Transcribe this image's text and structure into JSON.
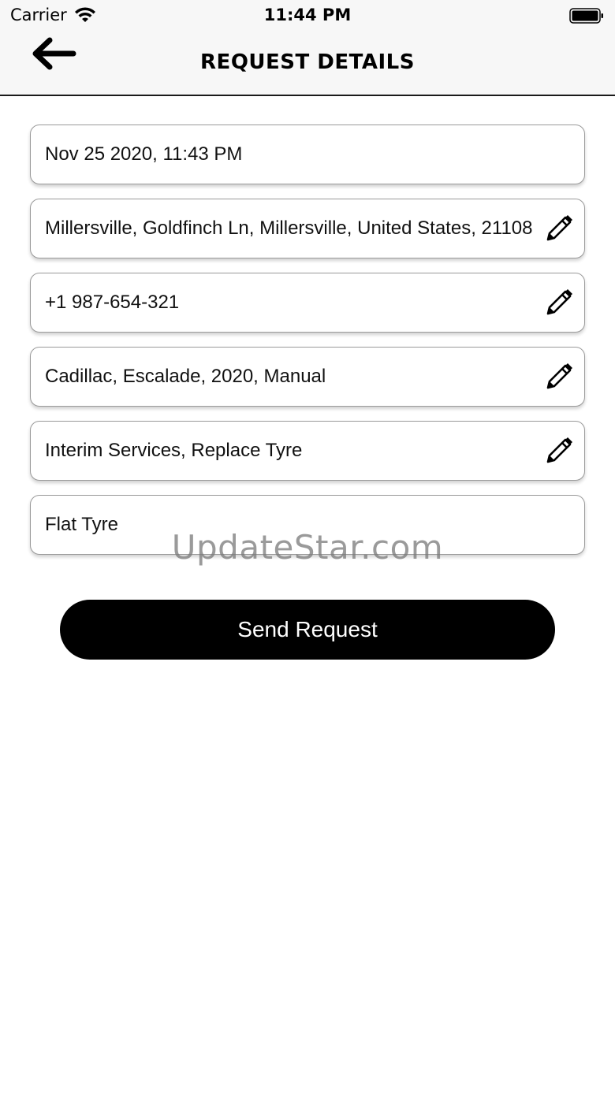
{
  "status_bar": {
    "carrier": "Carrier",
    "time": "11:44 PM"
  },
  "header": {
    "title": "REQUEST DETAILS",
    "back_icon": "arrow-left-icon"
  },
  "fields": [
    {
      "value": "Nov 25 2020, 11:43 PM",
      "editable": false
    },
    {
      "value": "Millersville, Goldfinch Ln, Millersville, United States, 21108",
      "editable": true
    },
    {
      "value": "+1 987-654-321",
      "editable": true
    },
    {
      "value": "Cadillac, Escalade, 2020, Manual",
      "editable": true
    },
    {
      "value": "Interim Services, Replace Tyre",
      "editable": true
    },
    {
      "value": "Flat Tyre",
      "editable": false
    }
  ],
  "watermark": "UpdateStar.com",
  "actions": {
    "send_label": "Send Request"
  },
  "colors": {
    "primary": "#000000",
    "header_bg": "#f7f7f7",
    "field_border": "#9a9a9a"
  }
}
